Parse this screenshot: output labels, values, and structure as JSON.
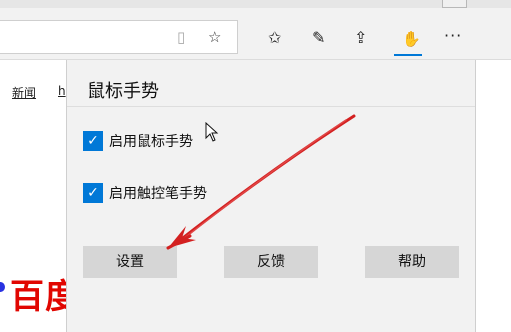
{
  "toolbar": {
    "icons": [
      "reading-view-icon",
      "favorite-star-icon",
      "favorites-list-icon",
      "pen-icon",
      "share-icon",
      "gesture-extension-icon",
      "more-icon"
    ],
    "more_glyph": "···"
  },
  "page": {
    "link_news": "新闻",
    "link_partial": "h",
    "logo_text": "百度"
  },
  "panel": {
    "title": "鼠标手势",
    "options": [
      {
        "label": "启用鼠标手势",
        "checked": true
      },
      {
        "label": "启用触控笔手势",
        "checked": true
      }
    ],
    "buttons": {
      "settings": "设置",
      "feedback": "反馈",
      "help": "帮助"
    }
  },
  "colors": {
    "accent": "#0078d7",
    "annotation_arrow": "#d32020",
    "logo": "#e10601"
  }
}
